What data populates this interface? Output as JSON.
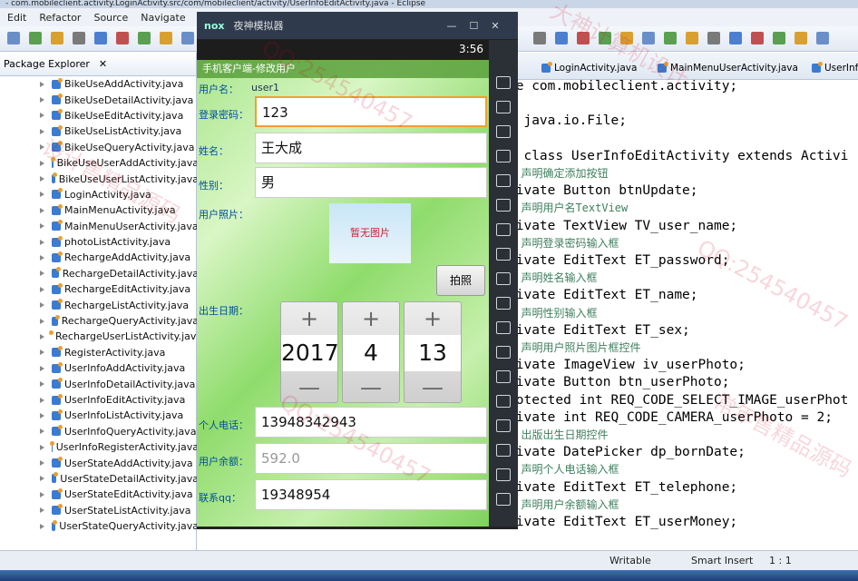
{
  "window": {
    "title": "- com.mobileclient.activity.LoginActivity.src/com/mobileclient/activity/UserInfoEditActivity.java - Eclipse"
  },
  "menu": [
    "Edit",
    "Refactor",
    "Source",
    "Navigate",
    "Se"
  ],
  "package_explorer": {
    "title": "Package Explorer",
    "files": [
      "BikeUseAddActivity.java",
      "BikeUseDetailActivity.java",
      "BikeUseEditActivity.java",
      "BikeUseListActivity.java",
      "BikeUseQueryActivity.java",
      "BikeUseUserAddActivity.java",
      "BikeUseUserListActivity.java",
      "LoginActivity.java",
      "MainMenuActivity.java",
      "MainMenuUserActivity.java",
      "photoListActivity.java",
      "RechargeAddActivity.java",
      "RechargeDetailActivity.java",
      "RechargeEditActivity.java",
      "RechargeListActivity.java",
      "RechargeQueryActivity.java",
      "RechargeUserListActivity.java",
      "RegisterActivity.java",
      "UserInfoAddActivity.java",
      "UserInfoDetailActivity.java",
      "UserInfoEditActivity.java",
      "UserInfoListActivity.java",
      "UserInfoQueryActivity.java",
      "UserInfoRegisterActivity.java",
      "UserStateAddActivity.java",
      "UserStateDetailActivity.java",
      "UserStateEditActivity.java",
      "UserStateListActivity.java",
      "UserStateQueryActivity.java"
    ]
  },
  "editor_tabs": [
    "LoginActivity.java",
    "MainMenuUserActivity.java",
    "UserInfo"
  ],
  "code": [
    "ge com.mobileclient.activity;",
    "",
    "t java.io.File;",
    "",
    "c class UserInfoEditActivity extends Activi",
    "/ 声明确定添加按钮",
    "rivate Button btnUpdate;",
    "/ 声明用户名TextView",
    "rivate TextView TV_user_name;",
    "/ 声明登录密码输入框",
    "rivate EditText ET_password;",
    "/ 声明姓名输入框",
    "rivate EditText ET_name;",
    "/ 声明性别输入框",
    "rivate EditText ET_sex;",
    "/ 声明用户照片图片框控件",
    "rivate ImageView iv_userPhoto;",
    "rivate Button btn_userPhoto;",
    "rotected int REQ_CODE_SELECT_IMAGE_userPhot",
    "rivate int REQ_CODE_CAMERA_userPhoto = 2;",
    "/ 出版出生日期控件",
    "rivate DatePicker dp_bornDate;",
    "/ 声明个人电话输入框",
    "rivate EditText ET_telephone;",
    "/ 声明用户余额输入框",
    "rivate EditText ET_userMoney;"
  ],
  "status": {
    "writable": "Writable",
    "insert": "Smart Insert",
    "position": "1 : 1"
  },
  "emulator": {
    "brand": "nox",
    "title": "夜神模拟器",
    "time": "3:56"
  },
  "app": {
    "title": "手机客户端-修改用户",
    "username_label": "用户名：",
    "username": "user1",
    "password_label": "登录密码：",
    "password": "123",
    "name_label": "姓名：",
    "name": "王大成",
    "sex_label": "性别：",
    "sex": "男",
    "photo_label": "用户照片：",
    "no_photo": "暂无图片",
    "capture_button": "拍照",
    "birth_label": "出生日期：",
    "year": "2017",
    "month": "4",
    "day": "13",
    "phone_label": "个人电话：",
    "phone": "13948342943",
    "balance_label": "用户余额：",
    "balance": "592.0",
    "qq_label": "联系qq：",
    "qq": "19348954"
  },
  "watermark": [
    "大神计算机设计",
    "QQ:254540457",
    "常年售精品源码",
    "设计售精品源码"
  ]
}
